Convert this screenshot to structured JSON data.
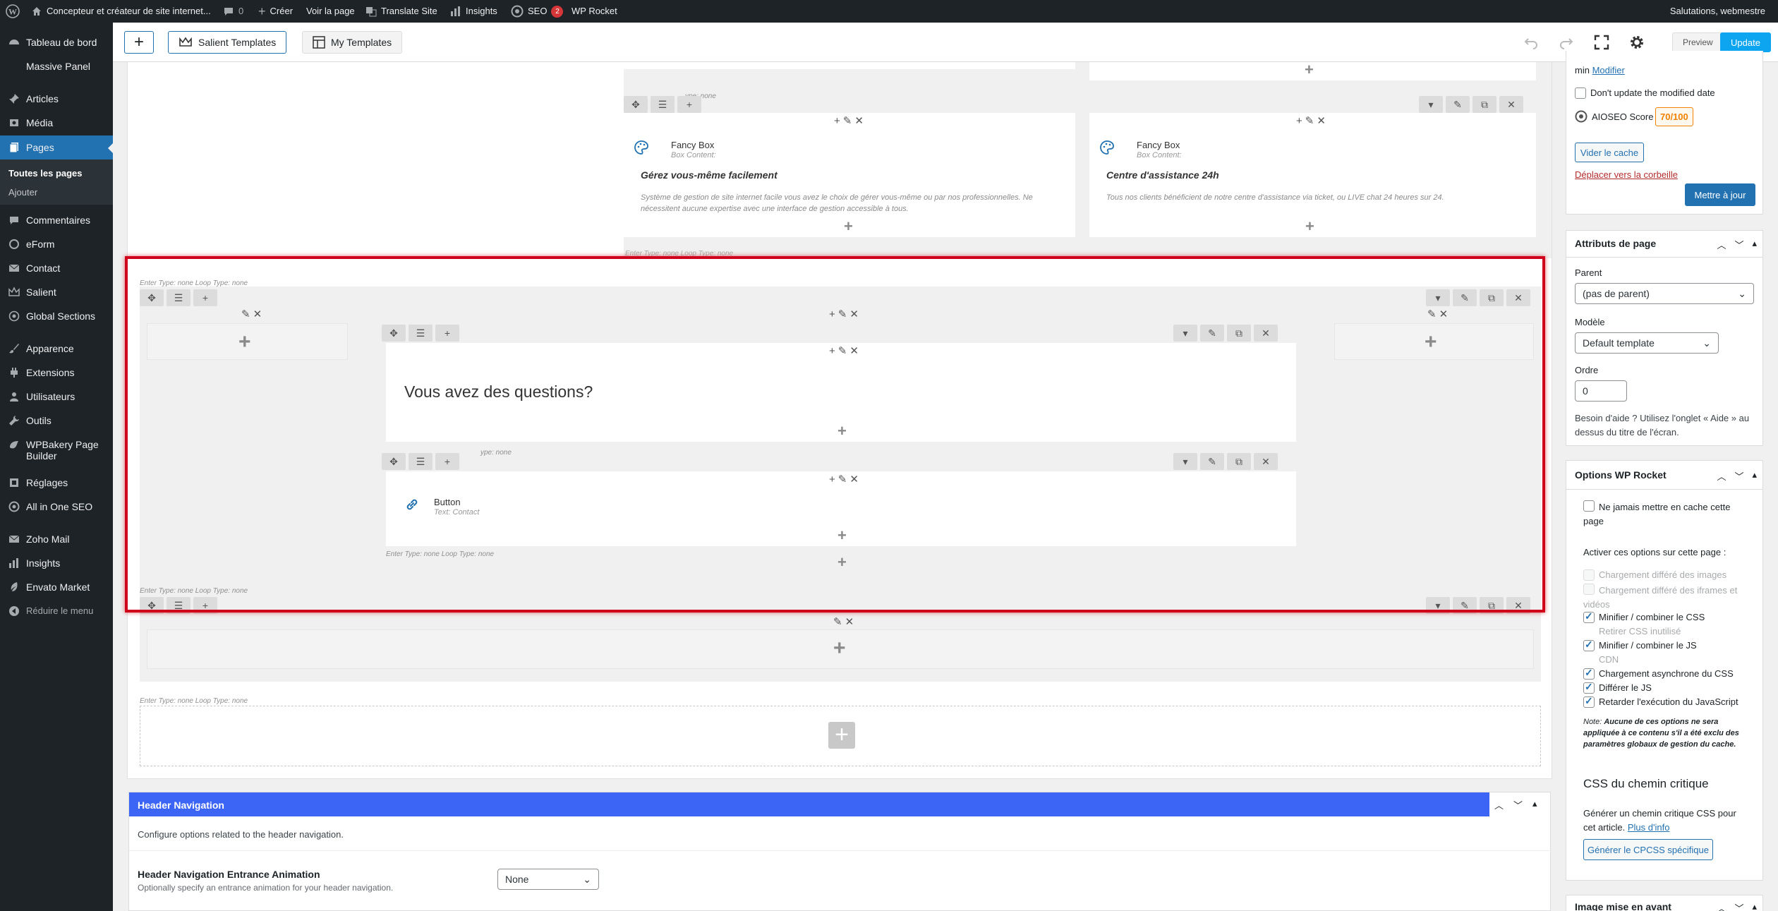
{
  "adminbar": {
    "site_name": "Concepteur et créateur de site internet...",
    "comments_count": "0",
    "create": "Créer",
    "view_page": "Voir la page",
    "translate": "Translate Site",
    "insights": "Insights",
    "seo": "SEO",
    "seo_badge": "2",
    "wp_rocket": "WP Rocket",
    "greeting": "Salutations, webmestre"
  },
  "sidebar": {
    "items": [
      {
        "label": "Tableau de bord",
        "icon": "dashboard-icon"
      },
      {
        "label": "Massive Panel",
        "icon": "massive-panel-icon"
      },
      {
        "label": "Articles",
        "icon": "pin-icon"
      },
      {
        "label": "Média",
        "icon": "media-icon"
      },
      {
        "label": "Pages",
        "icon": "pages-icon"
      },
      {
        "label": "Commentaires",
        "icon": "comment-icon"
      },
      {
        "label": "eForm",
        "icon": "eform-icon"
      },
      {
        "label": "Contact",
        "icon": "mail-icon"
      },
      {
        "label": "Salient",
        "icon": "salient-icon"
      },
      {
        "label": "Global Sections",
        "icon": "global-sections-icon"
      },
      {
        "label": "Apparence",
        "icon": "brush-icon"
      },
      {
        "label": "Extensions",
        "icon": "plugin-icon"
      },
      {
        "label": "Utilisateurs",
        "icon": "users-icon"
      },
      {
        "label": "Outils",
        "icon": "wrench-icon"
      },
      {
        "label": "WPBakery Page Builder",
        "icon": "wpbakery-icon"
      },
      {
        "label": "Réglages",
        "icon": "settings-icon"
      },
      {
        "label": "All in One SEO",
        "icon": "aioseo-icon"
      },
      {
        "label": "Zoho Mail",
        "icon": "zoho-mail-icon"
      },
      {
        "label": "Insights",
        "icon": "insights-icon"
      },
      {
        "label": "Envato Market",
        "icon": "envato-icon"
      },
      {
        "label": "Réduire le menu",
        "icon": "collapse-icon"
      }
    ],
    "submenu": {
      "all_pages": "Toutes les pages",
      "add": "Ajouter"
    }
  },
  "toolbar": {
    "salient_templates": "Salient Templates",
    "my_templates": "My Templates",
    "preview": "Preview",
    "update": "Update"
  },
  "editor": {
    "loop_text": "Enter Type: none  Loop Type: none",
    "loop_text_partial": "ype: none",
    "fancy_box_1": {
      "title": "Fancy Box",
      "sub": "Box Content:",
      "heading": "Gérez vous-même facilement",
      "desc": "Système de gestion de site internet facile vous avez le choix de gérer vous-même ou par nos professionnelles. Ne nécessitent aucune expertise avec une interface de gestion accessible à tous."
    },
    "fancy_box_2": {
      "title": "Fancy Box",
      "sub": "Box Content:",
      "heading": "Centre d'assistance 24h",
      "desc": "Tous nos clients bénéficient de notre centre d'assistance via ticket, ou LIVE chat 24 heures sur 24."
    },
    "question_heading": "Vous avez des questions?",
    "button_element": {
      "title": "Button",
      "sub": "Text: Contact"
    }
  },
  "header_nav": {
    "title": "Header Navigation",
    "desc": "Configure options related to the header navigation.",
    "field_label": "Header Navigation Entrance Animation",
    "field_help": "Optionally specify an entrance animation for your header navigation.",
    "field_value": "None"
  },
  "publish": {
    "min_text": "min",
    "modify": "Modifier",
    "dont_update": "Don't update the modified date",
    "aioseo_label": "AIOSEO Score",
    "aioseo_score": "70/100",
    "clear_cache": "Vider le cache",
    "trash": "Déplacer vers la corbeille",
    "update_btn": "Mettre à jour"
  },
  "page_attributes": {
    "title": "Attributs de page",
    "parent_label": "Parent",
    "parent_value": "(pas de parent)",
    "model_label": "Modèle",
    "model_value": "Default template",
    "order_label": "Ordre",
    "order_value": "0",
    "help": "Besoin d'aide ? Utilisez l'onglet « Aide » au dessus du titre de l'écran."
  },
  "wp_rocket": {
    "title": "Options WP Rocket",
    "never_cache": "Ne jamais mettre en cache cette page",
    "activate_label": "Activer ces options sur cette page :",
    "options": [
      {
        "label": "Chargement différé des images",
        "checked": false,
        "disabled": true
      },
      {
        "label": "Chargement différé des iframes et vidéos",
        "checked": false,
        "disabled": true
      },
      {
        "label": "Minifier / combiner le CSS",
        "checked": true,
        "disabled": false
      },
      {
        "label": "Retirer CSS inutilisé",
        "checked": false,
        "disabled": true
      },
      {
        "label": "Minifier / combiner le JS",
        "checked": true,
        "disabled": false
      },
      {
        "label": "CDN",
        "checked": false,
        "disabled": true
      },
      {
        "label": "Chargement asynchrone du CSS",
        "checked": true,
        "disabled": false
      },
      {
        "label": "Différer le JS",
        "checked": true,
        "disabled": false
      },
      {
        "label": "Retarder l'exécution du JavaScript",
        "checked": true,
        "disabled": false
      }
    ],
    "note_prefix": "Note:",
    "note": "Aucune de ces options ne sera appliquée à ce contenu s'il a été exclu des paramètres globaux de gestion du cache.",
    "critical_title": "CSS du chemin critique",
    "critical_desc": "Générer un chemin critique CSS pour cet article.",
    "more_info": "Plus d'info",
    "generate_btn": "Générer le CPCSS spécifique"
  },
  "featured_image": {
    "title": "Image mise en avant"
  }
}
